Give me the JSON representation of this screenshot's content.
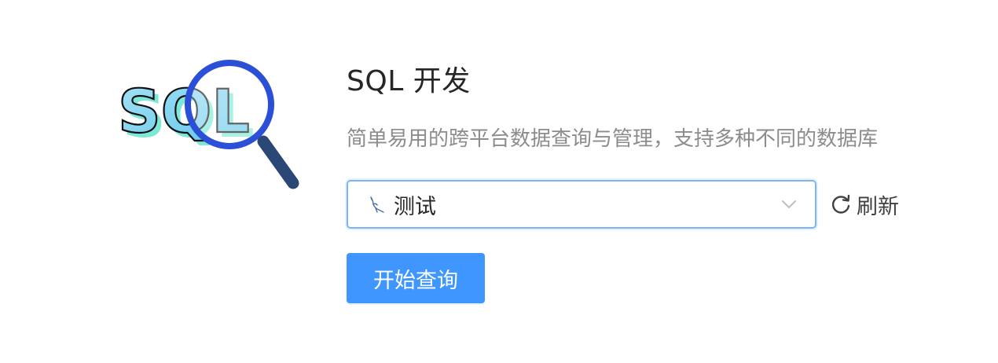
{
  "title": "SQL 开发",
  "subtitle": "简单易用的跨平台数据查询与管理，支持多种不同的数据库",
  "illustration": {
    "text": "SQL",
    "icon": "magnifier-icon"
  },
  "datasource_select": {
    "selected_value": "测试",
    "db_icon": "mysql-dolphin-icon",
    "dropdown_icon": "chevron-down-icon"
  },
  "refresh": {
    "label": "刷新",
    "icon": "refresh-icon"
  },
  "start_query_button": {
    "label": "开始查询"
  },
  "colors": {
    "primary": "#4096ff",
    "select_border": "#7cb5f5",
    "title": "#262626",
    "subtitle": "#8c8c8c",
    "magnifier_ring": "#2b4fd6",
    "magnifier_handle": "#2a4775",
    "letter_fill": "#7fd3f0"
  }
}
